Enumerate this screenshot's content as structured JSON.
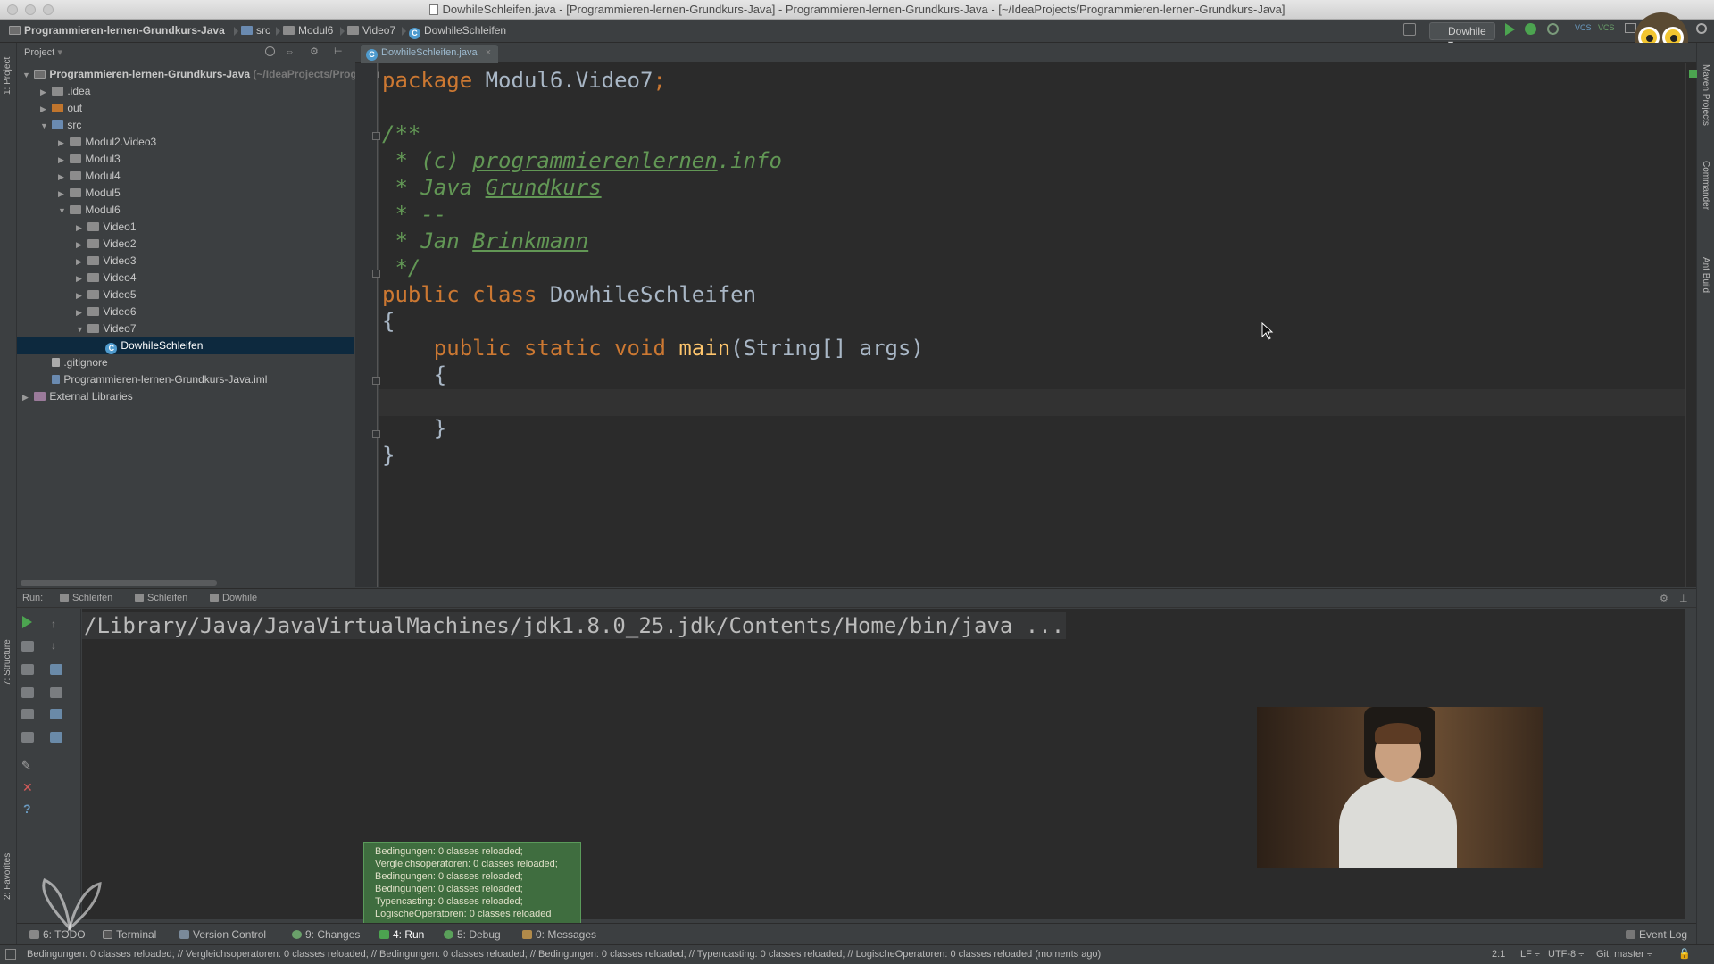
{
  "window_title": "DowhileSchleifen.java - [Programmieren-lernen-Grundkurs-Java] - Programmieren-lernen-Grundkurs-Java - [~/IdeaProjects/Programmieren-lernen-Grundkurs-Java]",
  "breadcrumbs": [
    "Programmieren-lernen-Grundkurs-Java",
    "src",
    "Modul6",
    "Video7",
    "DowhileSchleifen"
  ],
  "run_config": "Dowhile",
  "tool_stripe": {
    "left_top": "1: Project",
    "left_bottom_1": "7: Structure",
    "left_bottom_2": "2: Favorites",
    "right_1": "Maven Projects",
    "right_2": "Commander",
    "right_3": "Ant Build"
  },
  "project_panel": {
    "header": "Project",
    "tree": [
      {
        "label": "Programmieren-lernen-Grundkurs-Java",
        "suffix": " (~/IdeaProjects/Programmieren-lernen-Grundkurs-Java)",
        "level": 0,
        "expanded": true,
        "kind": "module"
      },
      {
        "label": ".idea",
        "level": 1,
        "expanded": false,
        "kind": "folder"
      },
      {
        "label": "out",
        "level": 1,
        "expanded": false,
        "kind": "folder-orange"
      },
      {
        "label": "src",
        "level": 1,
        "expanded": true,
        "kind": "folder-src"
      },
      {
        "label": "Modul2.Video3",
        "level": 2,
        "expanded": false,
        "kind": "package"
      },
      {
        "label": "Modul3",
        "level": 2,
        "expanded": false,
        "kind": "package"
      },
      {
        "label": "Modul4",
        "level": 2,
        "expanded": false,
        "kind": "package"
      },
      {
        "label": "Modul5",
        "level": 2,
        "expanded": false,
        "kind": "package"
      },
      {
        "label": "Modul6",
        "level": 2,
        "expanded": true,
        "kind": "package"
      },
      {
        "label": "Video1",
        "level": 3,
        "expanded": false,
        "kind": "package"
      },
      {
        "label": "Video2",
        "level": 3,
        "expanded": false,
        "kind": "package"
      },
      {
        "label": "Video3",
        "level": 3,
        "expanded": false,
        "kind": "package"
      },
      {
        "label": "Video4",
        "level": 3,
        "expanded": false,
        "kind": "package"
      },
      {
        "label": "Video5",
        "level": 3,
        "expanded": false,
        "kind": "package"
      },
      {
        "label": "Video6",
        "level": 3,
        "expanded": false,
        "kind": "package"
      },
      {
        "label": "Video7",
        "level": 3,
        "expanded": true,
        "kind": "package"
      },
      {
        "label": "DowhileSchleifen",
        "level": 4,
        "kind": "class",
        "selected": true
      },
      {
        "label": ".gitignore",
        "level": 1,
        "kind": "file"
      },
      {
        "label": "Programmieren-lernen-Grundkurs-Java.iml",
        "level": 1,
        "kind": "iml"
      },
      {
        "label": "External Libraries",
        "level": 0,
        "expanded": false,
        "kind": "libs"
      }
    ]
  },
  "editor": {
    "tab_label": "DowhileSchleifen.java",
    "lines": [
      "package Modul6.Video7;",
      "",
      "/**",
      " * (c) programmierenlernen.info",
      " * Java Grundkurs",
      " * --",
      " * Jan Brinkmann",
      " */",
      "public class DowhileSchleifen",
      "{",
      "    public static void main(String[] args)",
      "    {",
      "",
      "    }",
      "}"
    ]
  },
  "run_panel": {
    "label": "Run:",
    "tabs": [
      "Schleifen",
      "Schleifen",
      "Dowhile"
    ],
    "command": "/Library/Java/JavaVirtualMachines/jdk1.8.0_25.jdk/Contents/Home/bin/java ..."
  },
  "notification": [
    "Bedingungen: 0 classes reloaded;",
    "Vergleichsoperatoren: 0 classes reloaded;",
    "Bedingungen: 0 classes reloaded;",
    "Bedingungen: 0 classes reloaded;",
    "Typencasting: 0 classes reloaded;",
    "LogischeOperatoren: 0 classes reloaded"
  ],
  "tool_windows": [
    {
      "label": "6: TODO"
    },
    {
      "label": "Terminal"
    },
    {
      "label": "Version Control"
    },
    {
      "label": "9: Changes"
    },
    {
      "label": "4: Run",
      "active": true
    },
    {
      "label": "5: Debug"
    },
    {
      "label": "0: Messages"
    }
  ],
  "event_log": "Event Log",
  "status": {
    "message": "Bedingungen: 0 classes reloaded; // Vergleichsoperatoren: 0 classes reloaded; // Bedingungen: 0 classes reloaded; // Bedingungen: 0 classes reloaded; // Typencasting: 0 classes reloaded; // LogischeOperatoren: 0 classes reloaded (moments ago)",
    "position": "2:1",
    "line_sep": "LF ÷",
    "encoding": "UTF-8 ÷",
    "vcs": "Git: master ÷"
  },
  "colors": {
    "editor_bg": "#2b2b2b",
    "keyword": "#cc7832",
    "comment": "#629755",
    "method": "#ffc66d",
    "text": "#a9b7c6",
    "selection": "#0d293e"
  }
}
